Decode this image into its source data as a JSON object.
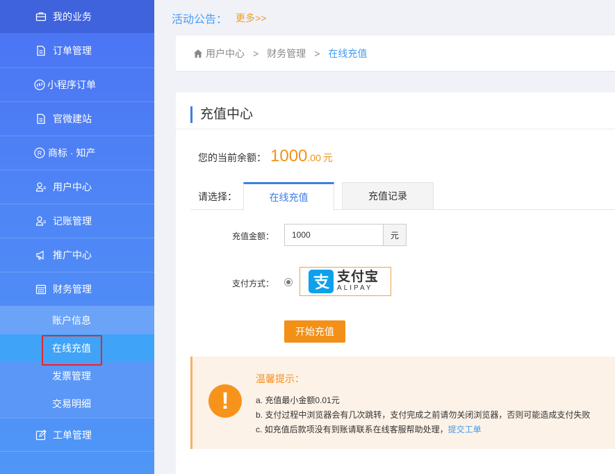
{
  "sidebar": {
    "items": [
      {
        "label": "我的业务",
        "icon": "briefcase-icon"
      },
      {
        "label": "订单管理",
        "icon": "document-icon"
      },
      {
        "label": "小程序订单",
        "icon": "miniprogram-icon"
      },
      {
        "label": "官微建站",
        "icon": "document-icon"
      },
      {
        "label": "商标 · 知产",
        "icon": "registered-icon"
      },
      {
        "label": "用户中心",
        "icon": "user-icon"
      },
      {
        "label": "记账管理",
        "icon": "user-icon"
      },
      {
        "label": "推广中心",
        "icon": "megaphone-icon"
      },
      {
        "label": "财务管理",
        "icon": "calendar-icon"
      }
    ],
    "sub_items": [
      {
        "label": "账户信息"
      },
      {
        "label": "在线充值"
      },
      {
        "label": "发票管理"
      },
      {
        "label": "交易明细"
      }
    ],
    "last_item": {
      "label": "工单管理",
      "icon": "edit-icon"
    }
  },
  "notice": {
    "label": "活动公告：",
    "more": "更多>>"
  },
  "breadcrumb": {
    "home": "用户中心",
    "sep": ">",
    "parent": "财务管理",
    "current": "在线充值"
  },
  "main": {
    "title": "充值中心",
    "balance_label": "您的当前余额：",
    "balance_int": "1000",
    "balance_dec": ".00",
    "balance_unit": "元",
    "choose_label": "请选择：",
    "tabs": [
      {
        "label": "在线充值"
      },
      {
        "label": "充值记录"
      }
    ],
    "amount_label": "充值金额：",
    "amount_value": "1000",
    "amount_unit": "元",
    "pay_label": "支付方式：",
    "alipay_cn": "支付宝",
    "alipay_en": "ALIPAY",
    "start_button": "开始充值"
  },
  "tips": {
    "title": "温馨提示：",
    "line_a": "a. 充值最小金额0.01元",
    "line_b": "b. 支付过程中浏览器会有几次跳转，支付完成之前请勿关闭浏览器，否则可能造成支付失败",
    "line_c": "c. 如充值后款项没有到账请联系在线客服帮助处理，",
    "line_c_link": "提交工单"
  },
  "colors": {
    "sidebar_top": "#4a72f3",
    "accent_blue": "#3e7de6",
    "accent_orange": "#f39017",
    "highlight_red": "#e3262a"
  }
}
